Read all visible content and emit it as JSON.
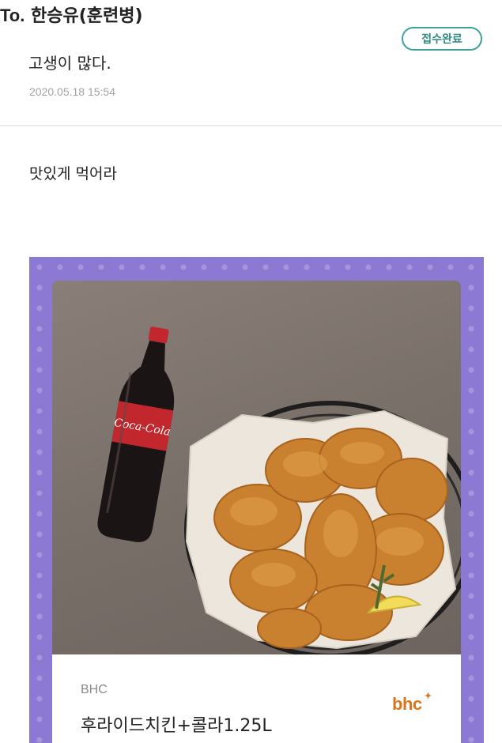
{
  "header": {
    "to_prefix": "To.",
    "recipient": "한승유(훈련병)"
  },
  "status_badge": "접수완료",
  "message": {
    "title": "고생이 많다.",
    "date": "2020.05.18 15:54",
    "body": "맛있게 먹어라"
  },
  "gift": {
    "brand": "BHC",
    "product_name": "후라이드치킨+콜라1.25L",
    "brand_logo": "bhc",
    "bottle_label": "Coca-Cola"
  },
  "colors": {
    "accent_teal": "#3fa29a",
    "card_purple": "#8b79d4",
    "brand_orange": "#d9761c"
  }
}
